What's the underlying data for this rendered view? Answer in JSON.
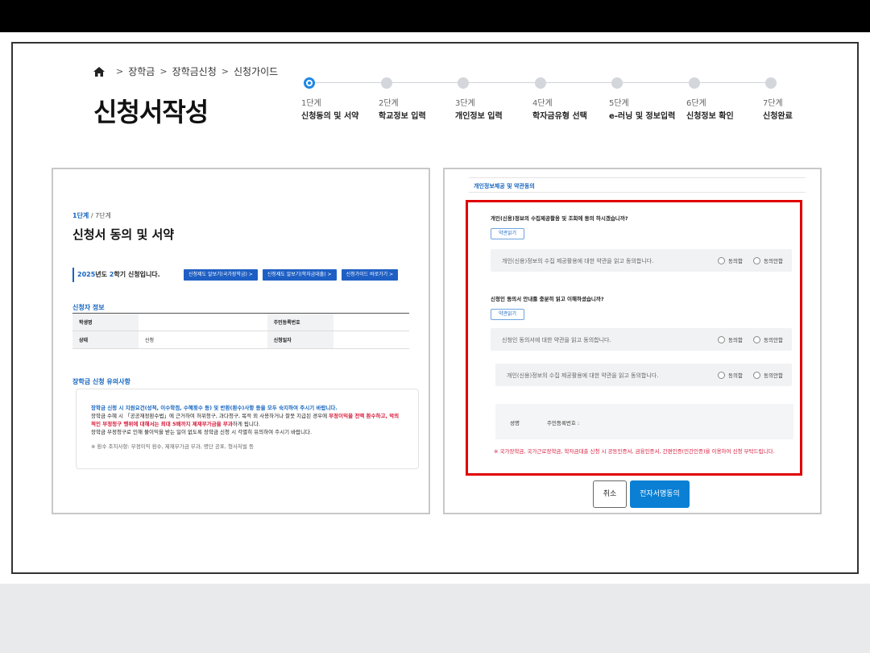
{
  "breadcrumb": {
    "items": [
      "장학금",
      "장학금신청",
      "신청가이드"
    ]
  },
  "page_title": "신청서작성",
  "steps": [
    {
      "num": "1단계",
      "name": "신청동의 및 서약",
      "active": true
    },
    {
      "num": "2단계",
      "name": "학교정보 입력",
      "active": false
    },
    {
      "num": "3단계",
      "name": "개인정보 입력",
      "active": false
    },
    {
      "num": "4단계",
      "name": "학자금유형 선택",
      "active": false
    },
    {
      "num": "5단계",
      "name": "e-러닝 및 정보입력",
      "active": false
    },
    {
      "num": "6단계",
      "name": "신청정보 확인",
      "active": false
    },
    {
      "num": "7단계",
      "name": "신청완료",
      "active": false
    }
  ],
  "left": {
    "step_current": "1단계",
    "step_total": " / 7단계",
    "title": "신청서 동의 및 서약",
    "semester_year": "2025",
    "semester_mid": "년도 ",
    "semester_term": "2",
    "semester_end": "학기 신청입니다.",
    "links": [
      "신청제도 알보기(국가장학금)",
      "신청제도 알보기(학자금대출)",
      "신청가이드 바로가기"
    ],
    "applicant_section": "신청자 정보",
    "table": {
      "row1": {
        "h1": "학생명",
        "v1": "",
        "h2": "주민등록번호",
        "v2": ""
      },
      "row2": {
        "h1": "상태",
        "v1": "신청",
        "h2": "신청일자",
        "v2": ""
      }
    },
    "notice_section": "장학금 신청 유의사항",
    "notice": {
      "line1": "장학금 신청 시 지원요건(성적, 이수학점, 수혜횟수 등) 및 반환(환수)사항 등을 모두 숙지하여 주시기 바랍니다.",
      "line2a": "장학금 수혜 시 「공공재정환수법」에 근거하여 허위청구, 과다청구, 목적 외 사용하거나 잘못 지급된 경우에 ",
      "line2b": "부정이익을 전액 환수하고, 악의적인 부정청구 행위에 대해서는 최대 5배까지 제재부가금을 부과",
      "line2c": "하게 됩니다.",
      "line3": "장학금 부정청구로 인해 불이익을 받는 일이 없도록 장학금 신청 시 각별히 유의하여 주시기 바랍니다.",
      "line4": "※ 환수 조치사항: 부정이익 환수, 제재부가금 부과, 명단 공표, 형사처벌 등"
    }
  },
  "right": {
    "section_title": "개인정보제공 및 약관동의",
    "q1": "개인(신용)정보의 수집제공활용 및 조회에 동의 하시겠습니까?",
    "view_label": "약관읽기",
    "row1_text": "개인(신용)정보의 수집 제공활용에 대한 약관을 읽고 동의합니다.",
    "agree": "동의함",
    "disagree": "동의안함",
    "q2": "신청인 동의서 안내를 충분히 읽고 이해하셨습니까?",
    "row2_text": "신청인 동의서에 대한 약관을 읽고 동의합니다.",
    "row3_text": "개인(신용)정보의 수집 제공활용에 대한 약관을 읽고 동의합니다.",
    "sig_name": "성명",
    "sig_rrn": "주민등록번호 :",
    "warning": "※ 국가장학금, 국가근로장학금, 학자금대출 신청 시 공동인증서, 금융인증서, 간편인증(민간인증)을 이용하여 신청 부탁드립니다.",
    "cancel": "취소",
    "sign": "전자서명동의"
  },
  "colors": {
    "accent": "#1e88e5",
    "link_button": "#1e5fc4",
    "highlight_box": "#e00000",
    "warning": "#d81b3c",
    "sign_button": "#0a7fd4"
  }
}
